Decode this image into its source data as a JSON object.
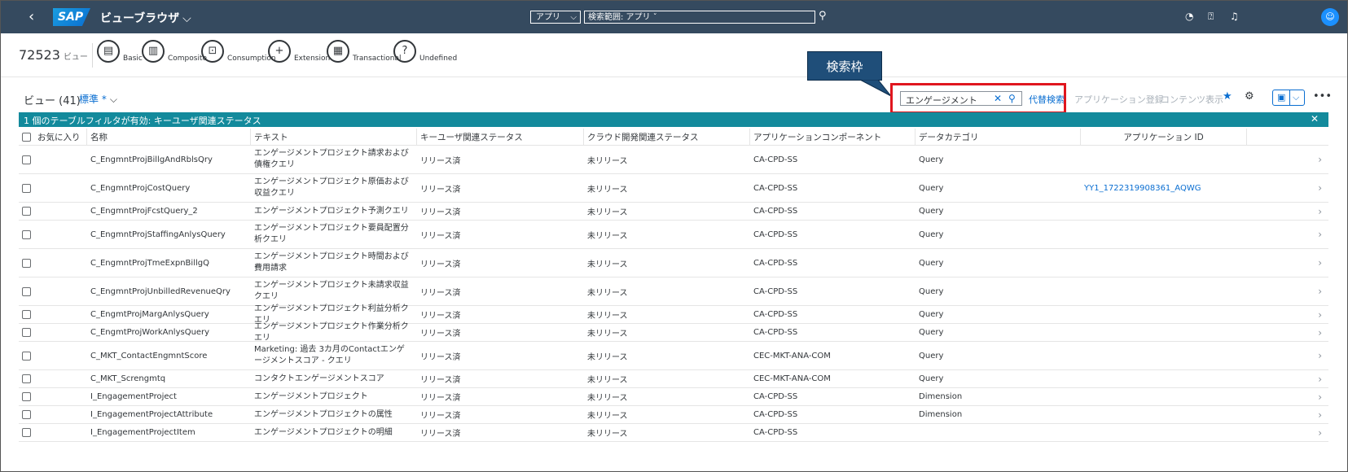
{
  "shell": {
    "back": "‹",
    "logo": "SAP",
    "app_title": "ビューブラウザ",
    "scope": "アプリ",
    "search_placeholder": "検索範囲: アプリ ˇ",
    "search_icon": "search-icon",
    "icons": [
      "help-circle-icon",
      "question-icon",
      "bell-icon"
    ],
    "avatar": "person-icon"
  },
  "header": {
    "count": "72523",
    "count_unit": "ビュー",
    "types": [
      "Basic",
      "Composite",
      "Consumption",
      "Extension",
      "Transactional",
      "Undefined"
    ]
  },
  "toolbar": {
    "title": "ビュー (41)",
    "variant": "標準 *",
    "callout": "検索枠",
    "search_value": "エンゲージメント",
    "alt_search": "代替検索",
    "register_app": "アプリケーション登録",
    "show_content": "コンテンツ表示"
  },
  "info": {
    "filter_text": "1 個のテーブルフィルタが有効: キーユーザ関連ステータス"
  },
  "table": {
    "columns": [
      "お気に入り",
      "名称",
      "テキスト",
      "キーユーザ関連ステータス",
      "クラウド開発関連ステータス",
      "アプリケーションコンポーネント",
      "データカテゴリ",
      "アプリケーション ID"
    ],
    "rows": [
      {
        "name": "C_EngmntProjBillgAndRblsQry",
        "text": "エンゲージメントプロジェクト請求および債権クエリ",
        "ku": "リリース済",
        "cloud": "未リリース",
        "comp": "CA-CPD-SS",
        "cat": "Query",
        "appid": ""
      },
      {
        "name": "C_EngmntProjCostQuery",
        "text": "エンゲージメントプロジェクト原価および収益クエリ",
        "ku": "リリース済",
        "cloud": "未リリース",
        "comp": "CA-CPD-SS",
        "cat": "Query",
        "appid": "YY1_1722319908361_AQWG"
      },
      {
        "name": "C_EngmntProjFcstQuery_2",
        "text": "エンゲージメントプロジェクト予測クエリ",
        "ku": "リリース済",
        "cloud": "未リリース",
        "comp": "CA-CPD-SS",
        "cat": "Query",
        "appid": ""
      },
      {
        "name": "C_EngmntProjStaffingAnlysQuery",
        "text": "エンゲージメントプロジェクト要員配置分析クエリ",
        "ku": "リリース済",
        "cloud": "未リリース",
        "comp": "CA-CPD-SS",
        "cat": "Query",
        "appid": ""
      },
      {
        "name": "C_EngmntProjTmeExpnBillgQ",
        "text": "エンゲージメントプロジェクト時間および費用請求",
        "ku": "リリース済",
        "cloud": "未リリース",
        "comp": "CA-CPD-SS",
        "cat": "Query",
        "appid": ""
      },
      {
        "name": "C_EngmntProjUnbilledRevenueQry",
        "text": "エンゲージメントプロジェクト未請求収益クエリ",
        "ku": "リリース済",
        "cloud": "未リリース",
        "comp": "CA-CPD-SS",
        "cat": "Query",
        "appid": ""
      },
      {
        "name": "C_EngmtProjMargAnlysQuery",
        "text": "エンゲージメントプロジェクト利益分析クエリ",
        "ku": "リリース済",
        "cloud": "未リリース",
        "comp": "CA-CPD-SS",
        "cat": "Query",
        "appid": ""
      },
      {
        "name": "C_EngmtProjWorkAnlysQuery",
        "text": "エンゲージメントプロジェクト作業分析クエリ",
        "ku": "リリース済",
        "cloud": "未リリース",
        "comp": "CA-CPD-SS",
        "cat": "Query",
        "appid": ""
      },
      {
        "name": "C_MKT_ContactEngmntScore",
        "text": "Marketing: 過去 3カ月のContactエンゲージメントスコア - クエリ",
        "ku": "リリース済",
        "cloud": "未リリース",
        "comp": "CEC-MKT-ANA-COM",
        "cat": "Query",
        "appid": ""
      },
      {
        "name": "C_MKT_Screngmtq",
        "text": "コンタクトエンゲージメントスコア",
        "ku": "リリース済",
        "cloud": "未リリース",
        "comp": "CEC-MKT-ANA-COM",
        "cat": "Query",
        "appid": ""
      },
      {
        "name": "I_EngagementProject",
        "text": "エンゲージメントプロジェクト",
        "ku": "リリース済",
        "cloud": "未リリース",
        "comp": "CA-CPD-SS",
        "cat": "Dimension",
        "appid": ""
      },
      {
        "name": "I_EngagementProjectAttribute",
        "text": "エンゲージメントプロジェクトの属性",
        "ku": "リリース済",
        "cloud": "未リリース",
        "comp": "CA-CPD-SS",
        "cat": "Dimension",
        "appid": ""
      },
      {
        "name": "I_EngagementProjectItem",
        "text": "エンゲージメントプロジェクトの明細",
        "ku": "リリース済",
        "cloud": "未リリース",
        "comp": "CA-CPD-SS",
        "cat": "",
        "appid": ""
      }
    ]
  },
  "colors": {
    "shell": "#354a5f",
    "accent": "#0a6ed1",
    "info": "#138a9c",
    "highlight": "#e0161e",
    "callout": "#1f4e79"
  }
}
